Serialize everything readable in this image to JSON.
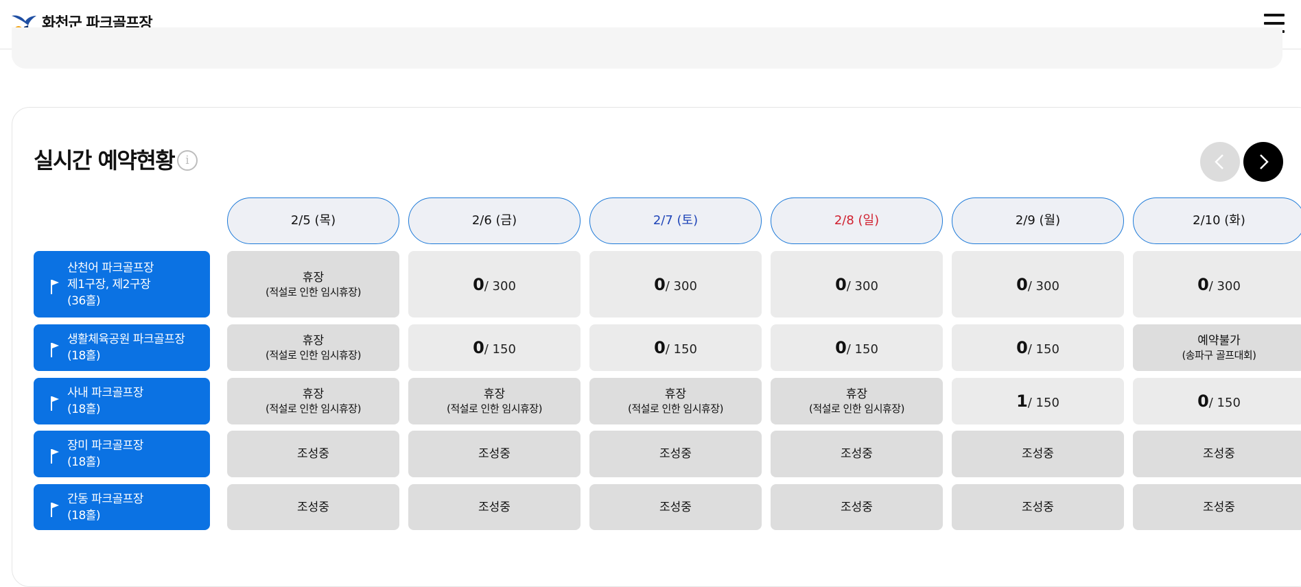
{
  "header": {
    "site_title": "화천군 파크골프장",
    "logo_icon": "hwacheon-bird-logo-icon",
    "menu_icon": "hamburger-menu-icon"
  },
  "reservation": {
    "title": "실시간 예약현황",
    "info_icon": "info-icon",
    "info_glyph": "i",
    "prev_icon": "chevron-left-icon",
    "next_icon": "chevron-right-icon",
    "dates": [
      {
        "label": "2/5 (목)",
        "weekday": "weekday"
      },
      {
        "label": "2/6 (금)",
        "weekday": "weekday"
      },
      {
        "label": "2/7 (토)",
        "weekday": "sat"
      },
      {
        "label": "2/8 (일)",
        "weekday": "sun"
      },
      {
        "label": "2/9 (월)",
        "weekday": "weekday"
      },
      {
        "label": "2/10 (화)",
        "weekday": "weekday"
      }
    ],
    "courses": [
      {
        "name": "산천어 파크골프장\n제1구장, 제2구장\n(36홀)",
        "flag_icon": "flag-icon",
        "cells": [
          {
            "type": "closed",
            "main": "휴장",
            "sub": "(적설로 인한 임시휴장)"
          },
          {
            "type": "avail",
            "count": "0",
            "cap": "/ 300"
          },
          {
            "type": "avail",
            "count": "0",
            "cap": "/ 300"
          },
          {
            "type": "avail",
            "count": "0",
            "cap": "/ 300"
          },
          {
            "type": "avail",
            "count": "0",
            "cap": "/ 300"
          },
          {
            "type": "avail",
            "count": "0",
            "cap": "/ 300"
          }
        ]
      },
      {
        "name": "생활체육공원 파크골프장\n(18홀)",
        "flag_icon": "flag-icon",
        "cells": [
          {
            "type": "closed",
            "main": "휴장",
            "sub": "(적설로 인한 임시휴장)"
          },
          {
            "type": "avail",
            "count": "0",
            "cap": "/ 150"
          },
          {
            "type": "avail",
            "count": "0",
            "cap": "/ 150"
          },
          {
            "type": "avail",
            "count": "0",
            "cap": "/ 150"
          },
          {
            "type": "avail",
            "count": "0",
            "cap": "/ 150"
          },
          {
            "type": "closed",
            "main": "예약불가",
            "sub": "(송파구 골프대회)"
          }
        ]
      },
      {
        "name": "사내 파크골프장\n(18홀)",
        "flag_icon": "flag-icon",
        "cells": [
          {
            "type": "closed",
            "main": "휴장",
            "sub": "(적설로 인한 임시휴장)"
          },
          {
            "type": "closed",
            "main": "휴장",
            "sub": "(적설로 인한 임시휴장)"
          },
          {
            "type": "closed",
            "main": "휴장",
            "sub": "(적설로 인한 임시휴장)"
          },
          {
            "type": "closed",
            "main": "휴장",
            "sub": "(적설로 인한 임시휴장)"
          },
          {
            "type": "avail",
            "count": "1",
            "cap": "/ 150"
          },
          {
            "type": "avail",
            "count": "0",
            "cap": "/ 150"
          }
        ]
      },
      {
        "name": "장미 파크골프장\n(18홀)",
        "flag_icon": "flag-icon",
        "cells": [
          {
            "type": "closed",
            "main": "조성중"
          },
          {
            "type": "closed",
            "main": "조성중"
          },
          {
            "type": "closed",
            "main": "조성중"
          },
          {
            "type": "closed",
            "main": "조성중"
          },
          {
            "type": "closed",
            "main": "조성중"
          },
          {
            "type": "closed",
            "main": "조성중"
          }
        ]
      },
      {
        "name": "간동 파크골프장\n(18홀)",
        "flag_icon": "flag-icon",
        "cells": [
          {
            "type": "closed",
            "main": "조성중"
          },
          {
            "type": "closed",
            "main": "조성중"
          },
          {
            "type": "closed",
            "main": "조성중"
          },
          {
            "type": "closed",
            "main": "조성중"
          },
          {
            "type": "closed",
            "main": "조성중"
          },
          {
            "type": "closed",
            "main": "조성중"
          }
        ]
      }
    ]
  },
  "colors": {
    "course_label_bg": "#0b72e3",
    "date_border": "#1a78d8",
    "saturday": "#1f45b8",
    "sunday": "#d0202f",
    "available_cell": "#ebebeb",
    "closed_cell": "#dddddd"
  }
}
